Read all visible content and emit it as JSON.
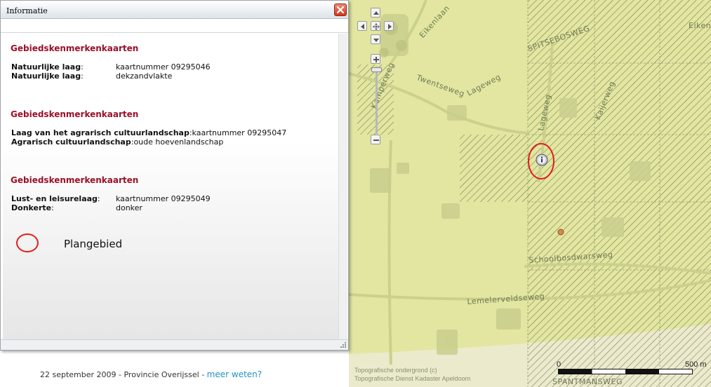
{
  "info_window": {
    "title": "Informatie",
    "sections": [
      {
        "title": "Gebiedskenmerkenkaarten",
        "rows": [
          {
            "label": "Natuurlijke laag",
            "colon": ":",
            "value": "kaartnummer 09295046"
          },
          {
            "label": "Natuurlijke laag",
            "colon": ":",
            "value": "dekzandvlakte"
          }
        ]
      },
      {
        "title": "Gebiedskenmerkenkaarten",
        "rows": [
          {
            "label": "Laag van het agrarisch cultuurlandschap",
            "colon": ":",
            "value": "kaartnummer 09295047"
          },
          {
            "label": "Agrarisch cultuurlandschap",
            "colon": ":",
            "value": "oude hoevenlandschap"
          }
        ]
      },
      {
        "title": "Gebiedskenmerkenkaarten",
        "rows": [
          {
            "label": "Lust- en leisurelaag",
            "colon": ":",
            "value": "kaartnummer 09295049"
          },
          {
            "label": "Donkerte",
            "colon": ":",
            "value": "donker"
          }
        ]
      }
    ],
    "legend": {
      "label": "Plangebied",
      "symbol_color": "#e01e1e"
    }
  },
  "footer": {
    "text": "22 september 2009 - Provincie Overijssel - ",
    "link": "meer weten?",
    "link_color": "#1f94c4"
  },
  "map": {
    "streets": [
      "Eikenlaan",
      "Twentseweg",
      "Lageweg",
      "Kamperweg",
      "SPITSEBOSWEG",
      "Lageweg",
      "Kaijerweg",
      "Schoolbosdwarsweg",
      "Lemelerveldseweg",
      "SPANTMANSWEG",
      "Eiken",
      "weg"
    ],
    "copyright_line1": "Topografische ondergrond (c)",
    "copyright_line2": "Topografische Dienst Kadaster Apeldoorn",
    "scale": {
      "start": "0",
      "end": "500 m"
    },
    "colors": {
      "land": "#e5e9a7",
      "highlight": "#e8ecb2",
      "plangebied": "#e01e1e",
      "marker": "#d98a4a"
    }
  }
}
